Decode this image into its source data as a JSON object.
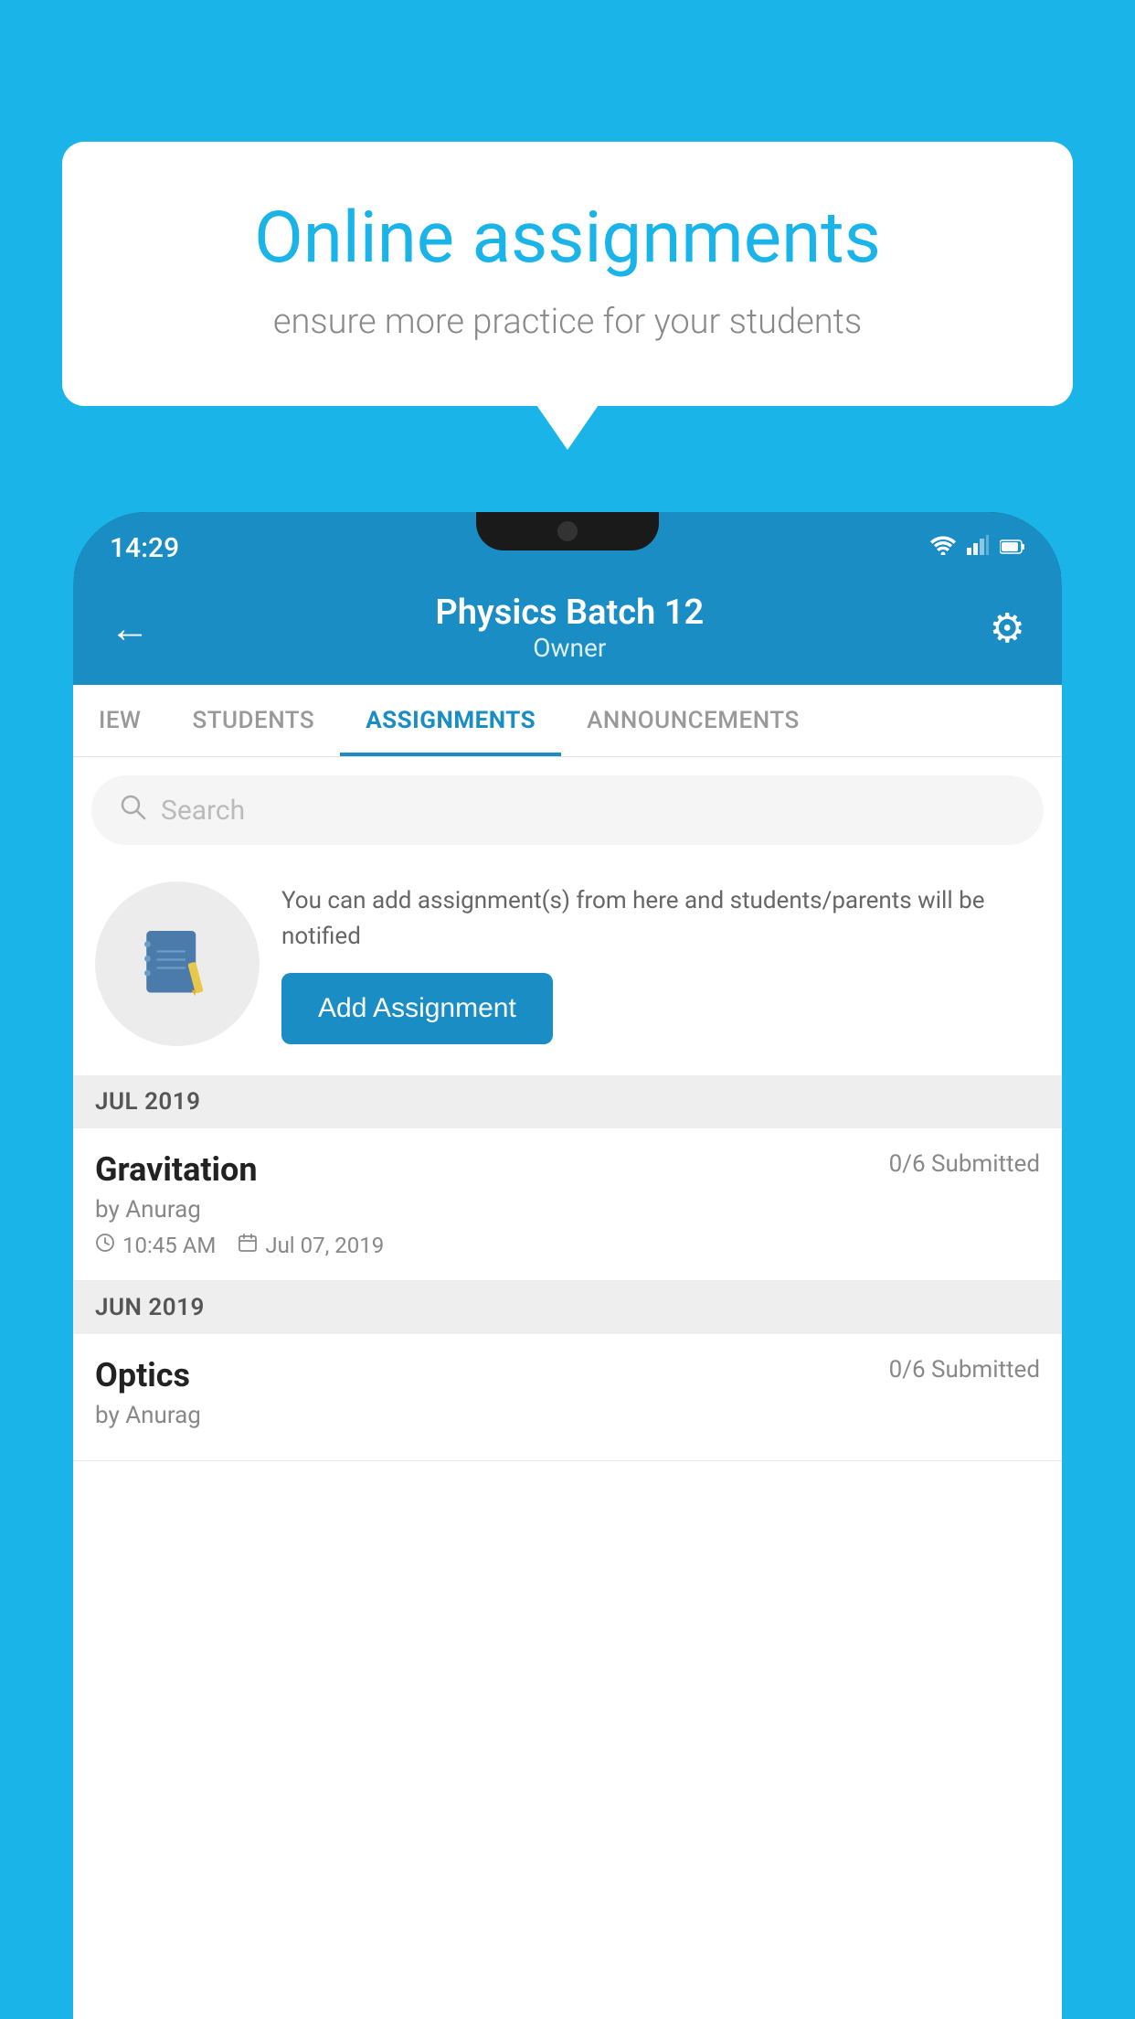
{
  "background": {
    "color": "#1ab4e8"
  },
  "speech_bubble": {
    "title": "Online assignments",
    "subtitle": "ensure more practice for your students"
  },
  "status_bar": {
    "time": "14:29",
    "icons": [
      "wifi",
      "signal",
      "battery"
    ]
  },
  "header": {
    "title": "Physics Batch 12",
    "subtitle": "Owner",
    "back_label": "←",
    "settings_label": "⚙"
  },
  "tabs": [
    {
      "label": "IEW",
      "active": false
    },
    {
      "label": "STUDENTS",
      "active": false
    },
    {
      "label": "ASSIGNMENTS",
      "active": true
    },
    {
      "label": "ANNOUNCEMENTS",
      "active": false
    }
  ],
  "search": {
    "placeholder": "Search"
  },
  "info_section": {
    "description": "You can add assignment(s) from here and students/parents will be notified",
    "button_label": "Add Assignment"
  },
  "sections": [
    {
      "month": "JUL 2019",
      "assignments": [
        {
          "title": "Gravitation",
          "submitted": "0/6 Submitted",
          "author": "by Anurag",
          "time": "10:45 AM",
          "date": "Jul 07, 2019"
        }
      ]
    },
    {
      "month": "JUN 2019",
      "assignments": [
        {
          "title": "Optics",
          "submitted": "0/6 Submitted",
          "author": "by Anurag",
          "time": "",
          "date": ""
        }
      ]
    }
  ]
}
